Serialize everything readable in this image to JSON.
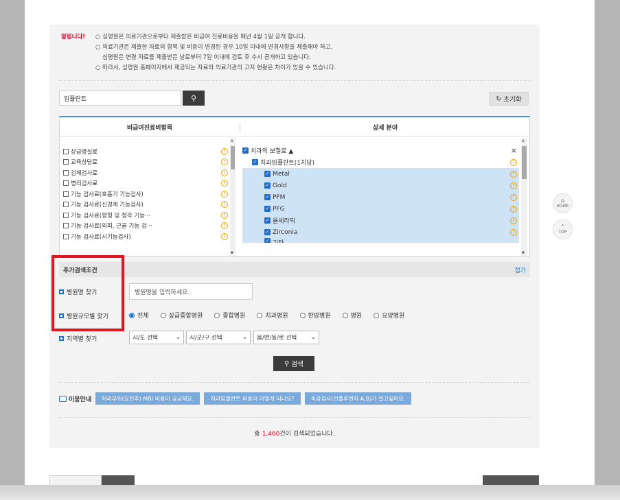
{
  "notice": {
    "title": "알립니다!",
    "lines": [
      "○ 심평원은 의료기관으로부터 제출받은 비급여 진료비용을 매년 4월 1일 공개 합니다.",
      "○ 의료기관은 제출한 자료의 항목 및 비용이 변경된 경우 10일 이내에 변경사항을 제출해야 하고,",
      "심평원은 변경 자료를 제출받은 날로부터 7일 이내에 검토 후 수시 공개하고 있습니다.",
      "○ 따라서, 심평원 홈페이지에서 제공되는 자료와 의료기관의 고지 현황은 차이가 있을 수 있습니다."
    ]
  },
  "search": {
    "keyword_value": "임플란트",
    "search_icon": "search-icon",
    "reset_label": "초기화"
  },
  "table": {
    "left_header": "비급여진료비항목",
    "right_header": "상세 분야",
    "left_items": [
      "상급병실료",
      "교육상담료",
      "검체검사료",
      "병리검사료",
      "기능 검사료(호흡기 기능검사)",
      "기능 검사료(신경계 기능검사)",
      "기능 검사료(평형 및 청각 기능···",
      "기능 검사료(외피, 근골 기능 검···",
      "기능 검사료(시기능검사)"
    ],
    "right_root": "치과의 보철료 ▲",
    "right_sub": "치과임플란트(1치당)",
    "right_leaves": [
      "Metal",
      "Gold",
      "PFM",
      "PFG",
      "올세라믹",
      "Zirconia",
      "기타"
    ]
  },
  "advanced": {
    "title": "추가검색조건",
    "fold_label": "접기",
    "hospital_name_label": "병원명 찾기",
    "hospital_name_placeholder": "병원명을 입력하세요.",
    "scale_label": "병원규모별 찾기",
    "scale_options": [
      "전체",
      "상급종합병원",
      "종합병원",
      "치과병원",
      "한방병원",
      "병원",
      "요양병원"
    ],
    "scale_selected": "전체",
    "region_label": "지역별 찾기",
    "region_selects": [
      "시/도 선택",
      "시/군/구 선택",
      "읍/면/동/로 선택"
    ],
    "search_button": "검색"
  },
  "guide": {
    "label": "이용안내",
    "buttons": [
      "허리부위(요천추) MRI 비용이 궁금해요.",
      "치과임플란트 비용이 어떻게 되나요?",
      "독감검사(인플루엔자 A,B)가 알고싶어요."
    ]
  },
  "result": {
    "prefix": "총 ",
    "count": "1,460",
    "suffix": "건이 검색되었습니다."
  },
  "side": {
    "home_label": "HOME",
    "top_label": "TOP"
  },
  "colors": {
    "accent": "#1f6fd1",
    "highlight_row": "#cfe3f7",
    "notice_red": "#e0002a",
    "annotation_box": "#e4151f"
  }
}
